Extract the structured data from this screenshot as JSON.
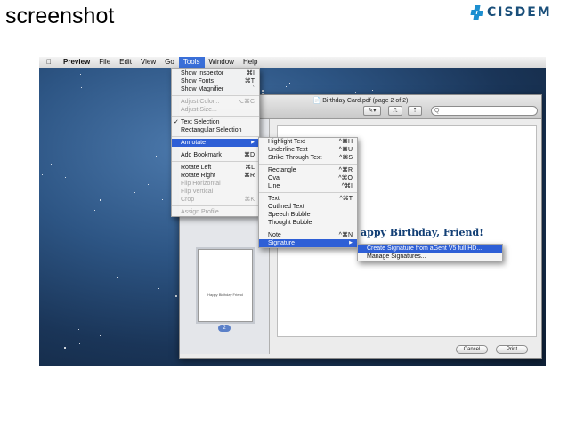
{
  "slide": {
    "title": "screenshot",
    "brand": "CISDEM"
  },
  "menubar": {
    "items": [
      "Preview",
      "File",
      "Edit",
      "View",
      "Go",
      "Tools",
      "Window",
      "Help"
    ],
    "active": "Tools"
  },
  "window": {
    "title": "Birthday Card.pdf (page 2 of 2)",
    "toolbar_buttons": [
      "✎▾",
      "⎍",
      "⇡"
    ],
    "search_placeholder": "Q",
    "page_badge": "2",
    "thumb_caption": "Happy Birthday Friend",
    "page_heading": "appy Birthday, Friend!",
    "cancel_label": "Cancel",
    "print_label": "Print"
  },
  "tools_menu": [
    {
      "label": "Show Inspector",
      "shortcut": "⌘I"
    },
    {
      "label": "Show Fonts",
      "shortcut": "⌘T"
    },
    {
      "label": "Show Magnifier",
      "shortcut": "`"
    },
    {
      "sep": true
    },
    {
      "label": "Adjust Color...",
      "shortcut": "⌥⌘C",
      "disabled": true
    },
    {
      "label": "Adjust Size...",
      "disabled": true
    },
    {
      "sep": true
    },
    {
      "label": "Text Selection",
      "checked": true
    },
    {
      "label": "Rectangular Selection"
    },
    {
      "sep": true
    },
    {
      "label": "Annotate",
      "submenu": true,
      "highlight": true
    },
    {
      "sep": true
    },
    {
      "label": "Add Bookmark",
      "shortcut": "⌘D"
    },
    {
      "sep": true
    },
    {
      "label": "Rotate Left",
      "shortcut": "⌘L"
    },
    {
      "label": "Rotate Right",
      "shortcut": "⌘R"
    },
    {
      "label": "Flip Horizontal",
      "disabled": true
    },
    {
      "label": "Flip Vertical",
      "disabled": true
    },
    {
      "label": "Crop",
      "shortcut": "⌘K",
      "disabled": true
    },
    {
      "sep": true
    },
    {
      "label": "Assign Profile...",
      "disabled": true
    }
  ],
  "annotate_menu": [
    {
      "label": "Highlight Text",
      "shortcut": "^⌘H"
    },
    {
      "label": "Underline Text",
      "shortcut": "^⌘U"
    },
    {
      "label": "Strike Through Text",
      "shortcut": "^⌘S"
    },
    {
      "sep": true
    },
    {
      "label": "Rectangle",
      "shortcut": "^⌘R"
    },
    {
      "label": "Oval",
      "shortcut": "^⌘O"
    },
    {
      "label": "Line",
      "shortcut": "^⌘I"
    },
    {
      "sep": true
    },
    {
      "label": "Text",
      "shortcut": "^⌘T"
    },
    {
      "label": "Outlined Text"
    },
    {
      "label": "Speech Bubble"
    },
    {
      "label": "Thought Bubble"
    },
    {
      "sep": true
    },
    {
      "label": "Note",
      "shortcut": "^⌘N"
    },
    {
      "label": "Signature",
      "submenu": true,
      "highlight": true
    }
  ],
  "signature_menu": [
    {
      "label": "Create Signature from aGent V5 full HD...",
      "highlight": true
    },
    {
      "label": "Manage Signatures..."
    }
  ],
  "colors": {
    "highlight": "#2e5fd6",
    "heading": "#123f75",
    "brand": "#1d8fd0"
  }
}
